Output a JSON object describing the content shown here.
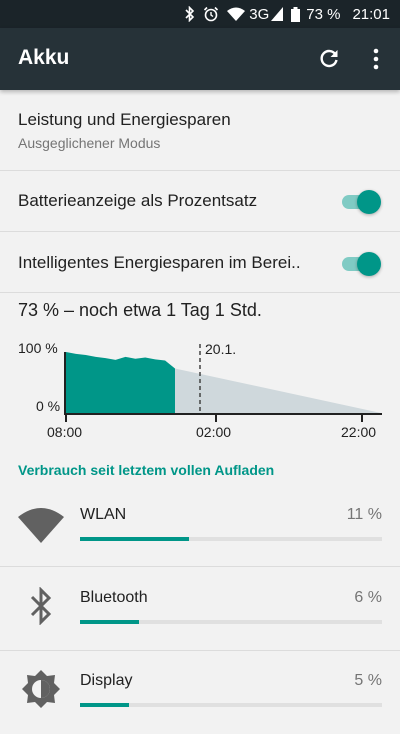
{
  "status_bar": {
    "network": "3G",
    "battery": "73 %",
    "time": "21:01",
    "icons": [
      "bluetooth-icon",
      "alarm-icon",
      "wifi-icon",
      "signal-icon",
      "battery-icon"
    ]
  },
  "app_bar": {
    "title": "Akku",
    "actions": [
      "refresh-icon",
      "more-vert-icon"
    ]
  },
  "prefs": {
    "power_saving": {
      "title": "Leistung und Energiesparen",
      "summary": "Ausgeglichener Modus"
    },
    "percentage": {
      "title": "Batterieanzeige als Prozentsatz",
      "checked": true
    },
    "smart_saving": {
      "title": "Intelligentes Energiesparen im Berei..",
      "checked": true
    }
  },
  "battery_status": "73 % – noch etwa 1 Tag 1 Std.",
  "chart_data": {
    "type": "area",
    "y_labels": [
      "100 %",
      "0 %"
    ],
    "x_labels": [
      "08:00",
      "02:00",
      "22:00"
    ],
    "marker_label": "20.1.",
    "series": [
      {
        "values_percent": [
          100,
          97,
          95,
          92,
          90,
          87,
          92,
          89,
          91,
          88,
          86,
          73
        ]
      }
    ],
    "projection_percent": [
      73,
      0
    ],
    "colors": {
      "history": "#009688",
      "projection": "#cfd8dc"
    }
  },
  "section_header": "Verbrauch seit letztem vollen Aufladen",
  "usage": [
    {
      "name": "WLAN",
      "percent_label": "11 %",
      "percent": 11,
      "icon": "wifi-icon"
    },
    {
      "name": "Bluetooth",
      "percent_label": "6 %",
      "percent": 6,
      "icon": "bluetooth-icon"
    },
    {
      "name": "Display",
      "percent_label": "5 %",
      "percent": 5,
      "icon": "brightness-icon"
    }
  ],
  "colors": {
    "accent": "#009688",
    "app_bar": "#263238",
    "status_bar": "#1b2429",
    "background": "#f2f2f2"
  }
}
